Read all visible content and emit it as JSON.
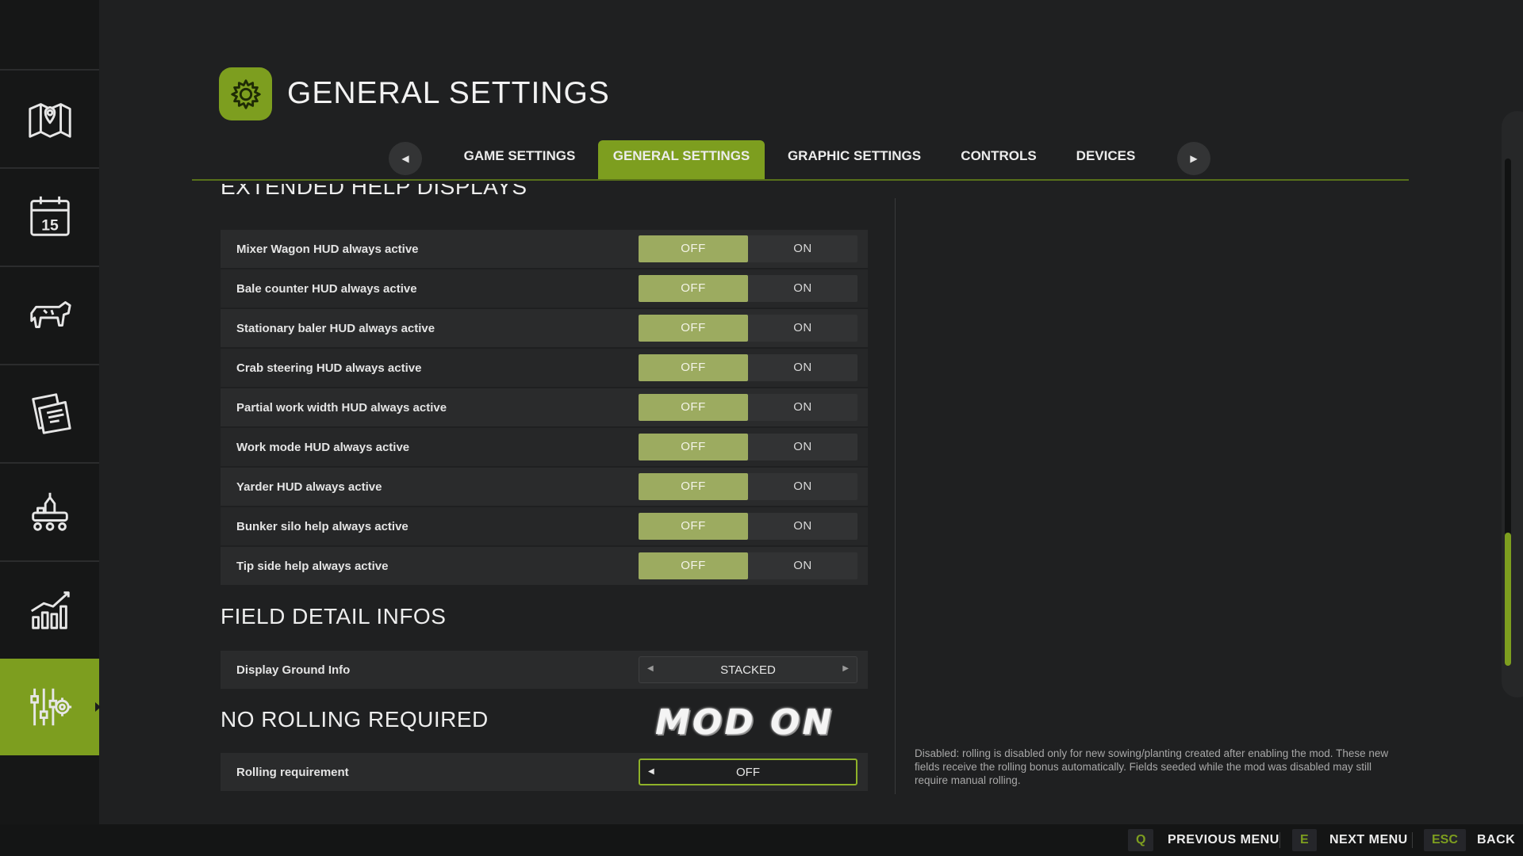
{
  "header": {
    "title": "GENERAL SETTINGS",
    "icon": "gear-icon"
  },
  "tabs": [
    {
      "label": "GAME SETTINGS",
      "active": false
    },
    {
      "label": "GENERAL SETTINGS",
      "active": true
    },
    {
      "label": "GRAPHIC SETTINGS",
      "active": false
    },
    {
      "label": "CONTROLS",
      "active": false
    },
    {
      "label": "DEVICES",
      "active": false
    }
  ],
  "sidebar": {
    "items": [
      {
        "icon": "map-icon",
        "active": false
      },
      {
        "icon": "calendar-icon",
        "active": false
      },
      {
        "icon": "animals-icon",
        "active": false
      },
      {
        "icon": "contracts-icon",
        "active": false
      },
      {
        "icon": "production-icon",
        "active": false
      },
      {
        "icon": "statistics-icon",
        "active": false
      },
      {
        "icon": "settings-icon",
        "active": true
      }
    ],
    "calendar_day": "15"
  },
  "sections": {
    "extended_help": {
      "title": "EXTENDED HELP DISPLAYS",
      "rows": [
        {
          "label": "Mixer Wagon HUD always active",
          "off": "OFF",
          "on": "ON",
          "value": "OFF"
        },
        {
          "label": "Bale counter HUD always active",
          "off": "OFF",
          "on": "ON",
          "value": "OFF"
        },
        {
          "label": "Stationary baler HUD always active",
          "off": "OFF",
          "on": "ON",
          "value": "OFF"
        },
        {
          "label": "Crab steering HUD always active",
          "off": "OFF",
          "on": "ON",
          "value": "OFF"
        },
        {
          "label": "Partial work width HUD always active",
          "off": "OFF",
          "on": "ON",
          "value": "OFF"
        },
        {
          "label": "Work mode HUD always active",
          "off": "OFF",
          "on": "ON",
          "value": "OFF"
        },
        {
          "label": "Yarder HUD always active",
          "off": "OFF",
          "on": "ON",
          "value": "OFF"
        },
        {
          "label": "Bunker silo help always active",
          "off": "OFF",
          "on": "ON",
          "value": "OFF"
        },
        {
          "label": "Tip side help always active",
          "off": "OFF",
          "on": "ON",
          "value": "OFF"
        }
      ]
    },
    "field_detail": {
      "title": "FIELD DETAIL INFOS",
      "rows": [
        {
          "label": "Display Ground Info",
          "value": "STACKED"
        }
      ]
    },
    "no_rolling": {
      "title": "NO ROLLING REQUIRED",
      "badge": "MOD ON",
      "rows": [
        {
          "label": "Rolling requirement",
          "value": "OFF"
        }
      ]
    }
  },
  "help_text": "Disabled: rolling is disabled only for new sowing/planting created after enabling the mod. These new fields receive the rolling bonus automatically. Fields seeded while the mod was disabled may still require manual rolling.",
  "footer": {
    "prev": {
      "key": "Q",
      "label": "PREVIOUS MENU"
    },
    "next": {
      "key": "E",
      "label": "NEXT MENU"
    },
    "back": {
      "key": "ESC",
      "label": "BACK"
    }
  },
  "colors": {
    "accent": "#7d9e1f",
    "toggle_selected": "#9cab60",
    "background": "#1f2021"
  }
}
